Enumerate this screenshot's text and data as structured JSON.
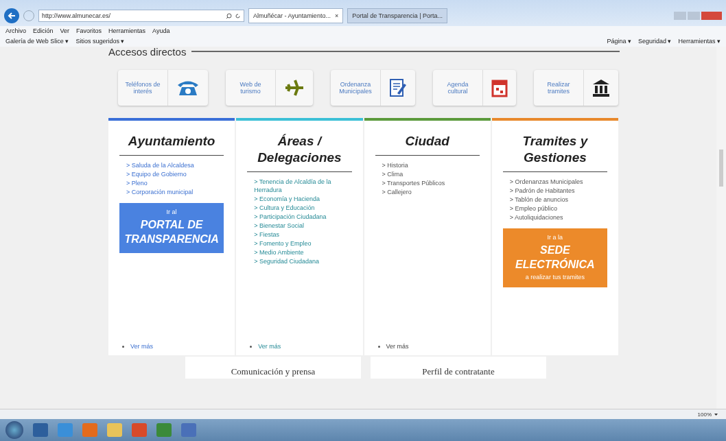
{
  "browser": {
    "address": "http://www.almunecar.es/",
    "tabs": [
      {
        "title": "Almuñécar - Ayuntamiento...",
        "close": "×",
        "selected": true
      },
      {
        "title": "Portal de Transparencia | Porta...",
        "selected": false
      }
    ],
    "menu": [
      "Archivo",
      "Edición",
      "Ver",
      "Favoritos",
      "Herramientas",
      "Ayuda"
    ],
    "favorites": [
      "Galería de Web Slice ▾",
      "Sitios sugeridos ▾"
    ],
    "commands": [
      "Página ▾",
      "Seguridad ▾",
      "Herramientas ▾"
    ]
  },
  "page": {
    "section_title": "Accesos directos",
    "shortcuts": [
      {
        "label": "Teléfonos de interés",
        "kind": "phone"
      },
      {
        "label": "Web de turismo",
        "kind": "plane"
      },
      {
        "label": "Ordenanza Municipales",
        "kind": "document"
      },
      {
        "label": "Agenda cultural",
        "kind": "calendar"
      },
      {
        "label": "Realizar tramites",
        "kind": "building"
      }
    ],
    "columns": [
      {
        "title": "Ayuntamiento",
        "color": "#3a6fd8",
        "links": [
          "> Saluda de la Alcaldesa",
          "> Equipo de Gobierno",
          "> Pleno",
          "> Corporación municipal"
        ],
        "button": {
          "pre": "Ir al",
          "title": "PORTAL DE TRANSPARENCIA",
          "color": "#4a82e0"
        },
        "more": "Ver más"
      },
      {
        "title": "Áreas / Delegaciones",
        "color": "#3cc0d6",
        "links": [
          "> Tenencia de Alcaldía de la Herradura",
          "> Economía y Hacienda",
          "> Cultura y Educación",
          "> Participación Ciudadana",
          "> Bienestar Social",
          "> Fiestas",
          "> Fomento y Empleo",
          "> Medio Ambiente",
          "> Seguridad Ciudadana"
        ],
        "more": "Ver más"
      },
      {
        "title": "Ciudad",
        "color": "#5b9a3c",
        "links": [
          "> Historia",
          "> Clima",
          "> Transportes Públicos",
          "> Callejero"
        ],
        "more": "Ver más"
      },
      {
        "title": "Tramites y Gestiones",
        "color": "#e8892c",
        "links": [
          "> Ordenanzas Municipales",
          "> Padrón de Habitantes",
          "> Tablón de anuncios",
          "> Empleo público",
          "> Autoliquidaciones"
        ],
        "button": {
          "pre": "Ir a la",
          "title": "SEDE ELECTRÓNICA",
          "post": "a realizar tus tramites",
          "color": "#ec8a2a"
        }
      }
    ],
    "bottom_links": [
      "Comunicación y prensa",
      "Perfil de contratante"
    ]
  },
  "status_bar": {
    "zoom": "100%"
  }
}
